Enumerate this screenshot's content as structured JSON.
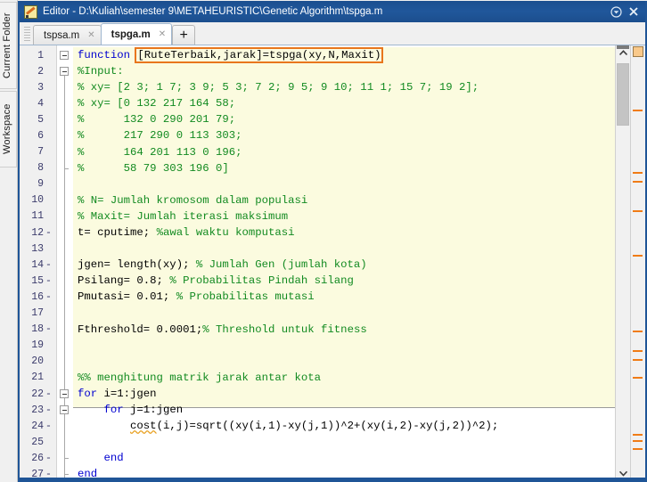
{
  "window": {
    "title": "Editor - D:\\Kuliah\\semester 9\\METAHEURISTIC\\Genetic Algorithm\\tspga.m",
    "icon": "matlab-editor-icon",
    "dropdown_label": "▼",
    "close_label": "✕",
    "accent_color": "#1f5597"
  },
  "left_dock": {
    "tabs": [
      {
        "label": "Current Folder"
      },
      {
        "label": "Workspace"
      }
    ]
  },
  "tabstrip": {
    "tabs": [
      {
        "label": "tspsa.m",
        "active": false,
        "close": "✕"
      },
      {
        "label": "tspga.m",
        "active": true,
        "close": "✕"
      }
    ],
    "add_label": "+"
  },
  "scrollbar": {
    "up_arrow": "▲",
    "down_arrow": "▼"
  },
  "editor": {
    "warning_color": "#e8761d",
    "keyword_color": "#0000d0",
    "comment_color": "#128a20",
    "cell_background": "#fbfbdf",
    "lines": [
      {
        "n": "1",
        "dash": "",
        "fold": "box",
        "parts": [
          {
            "t": "function ",
            "c": "kw"
          },
          {
            "t": "[RuteTerbaik,jarak]=tspga(xy,N,Maxit)",
            "c": "warn"
          }
        ]
      },
      {
        "n": "2",
        "dash": "",
        "fold": "box",
        "parts": [
          {
            "t": "%Input:",
            "c": "cm"
          }
        ]
      },
      {
        "n": "3",
        "dash": "",
        "fold": "",
        "parts": [
          {
            "t": "% xy= [2 3; 1 7; 3 9; 5 3; 7 2; 9 5; 9 10; 11 1; 15 7; 19 2];",
            "c": "cm"
          }
        ]
      },
      {
        "n": "4",
        "dash": "",
        "fold": "",
        "parts": [
          {
            "t": "% xy= [0 132 217 164 58;",
            "c": "cm"
          }
        ]
      },
      {
        "n": "5",
        "dash": "",
        "fold": "",
        "parts": [
          {
            "t": "%      132 0 290 201 79;",
            "c": "cm"
          }
        ]
      },
      {
        "n": "6",
        "dash": "",
        "fold": "",
        "parts": [
          {
            "t": "%      217 290 0 113 303;",
            "c": "cm"
          }
        ]
      },
      {
        "n": "7",
        "dash": "",
        "fold": "",
        "parts": [
          {
            "t": "%      164 201 113 0 196;",
            "c": "cm"
          }
        ]
      },
      {
        "n": "8",
        "dash": "",
        "fold": "tick",
        "parts": [
          {
            "t": "%      58 79 303 196 0]",
            "c": "cm"
          }
        ]
      },
      {
        "n": "9",
        "dash": "",
        "fold": "",
        "parts": [
          {
            "t": "",
            "c": "txt"
          }
        ]
      },
      {
        "n": "10",
        "dash": "",
        "fold": "",
        "parts": [
          {
            "t": "% N= Jumlah kromosom dalam populasi",
            "c": "cm"
          }
        ]
      },
      {
        "n": "11",
        "dash": "",
        "fold": "",
        "parts": [
          {
            "t": "% Maxit= Jumlah iterasi maksimum",
            "c": "cm"
          }
        ]
      },
      {
        "n": "12",
        "dash": "-",
        "fold": "",
        "parts": [
          {
            "t": "t= cputime; ",
            "c": "txt"
          },
          {
            "t": "%awal waktu komputasi",
            "c": "cm"
          }
        ]
      },
      {
        "n": "13",
        "dash": "",
        "fold": "",
        "parts": [
          {
            "t": "",
            "c": "txt"
          }
        ]
      },
      {
        "n": "14",
        "dash": "-",
        "fold": "",
        "parts": [
          {
            "t": "jgen= length(xy); ",
            "c": "txt"
          },
          {
            "t": "% Jumlah Gen (jumlah kota)",
            "c": "cm"
          }
        ]
      },
      {
        "n": "15",
        "dash": "-",
        "fold": "",
        "parts": [
          {
            "t": "Psilang= 0.8; ",
            "c": "txt"
          },
          {
            "t": "% Probabilitas Pindah silang",
            "c": "cm"
          }
        ]
      },
      {
        "n": "16",
        "dash": "-",
        "fold": "",
        "parts": [
          {
            "t": "Pmutasi= 0.01; ",
            "c": "txt"
          },
          {
            "t": "% Probabilitas mutasi",
            "c": "cm"
          }
        ]
      },
      {
        "n": "17",
        "dash": "",
        "fold": "",
        "parts": [
          {
            "t": "",
            "c": "txt"
          }
        ]
      },
      {
        "n": "18",
        "dash": "-",
        "fold": "",
        "parts": [
          {
            "t": "Fthreshold= 0.0001;",
            "c": "txt"
          },
          {
            "t": "% Threshold untuk fitness",
            "c": "cm"
          }
        ]
      },
      {
        "n": "19",
        "dash": "",
        "fold": "",
        "parts": [
          {
            "t": "",
            "c": "txt"
          }
        ]
      },
      {
        "n": "20",
        "dash": "",
        "fold": "",
        "parts": [
          {
            "t": "",
            "c": "txt"
          }
        ]
      },
      {
        "n": "21",
        "dash": "",
        "fold": "",
        "parts": [
          {
            "t": "%% menghitung matrik jarak antar kota",
            "c": "cm"
          }
        ]
      },
      {
        "n": "22",
        "dash": "-",
        "fold": "box",
        "parts": [
          {
            "t": "for",
            "c": "kw"
          },
          {
            "t": " i=1:jgen",
            "c": "txt"
          }
        ]
      },
      {
        "n": "23",
        "dash": "-",
        "fold": "box2",
        "parts": [
          {
            "t": "    ",
            "c": "txt"
          },
          {
            "t": "for",
            "c": "kw"
          },
          {
            "t": " j=1:jgen",
            "c": "txt"
          }
        ]
      },
      {
        "n": "24",
        "dash": "-",
        "fold": "",
        "parts": [
          {
            "t": "        ",
            "c": "txt"
          },
          {
            "t": "cost",
            "c": "squig"
          },
          {
            "t": "(i,j)=sqrt((xy(i,1)-xy(j,1))^2+(xy(i,2)-xy(j,2))^2);",
            "c": "txt"
          }
        ]
      },
      {
        "n": "25",
        "dash": "",
        "fold": "",
        "parts": [
          {
            "t": "",
            "c": "txt"
          }
        ]
      },
      {
        "n": "26",
        "dash": "-",
        "fold": "tick2",
        "parts": [
          {
            "t": "    ",
            "c": "txt"
          },
          {
            "t": "end",
            "c": "kw"
          }
        ]
      },
      {
        "n": "27",
        "dash": "-",
        "fold": "tick",
        "parts": [
          {
            "t": "end",
            "c": "kw"
          }
        ]
      }
    ]
  },
  "analyzer": {
    "status": "warnings",
    "marks": [
      72,
      142,
      152,
      185,
      235,
      320,
      342,
      352,
      372,
      436,
      443,
      452
    ]
  }
}
